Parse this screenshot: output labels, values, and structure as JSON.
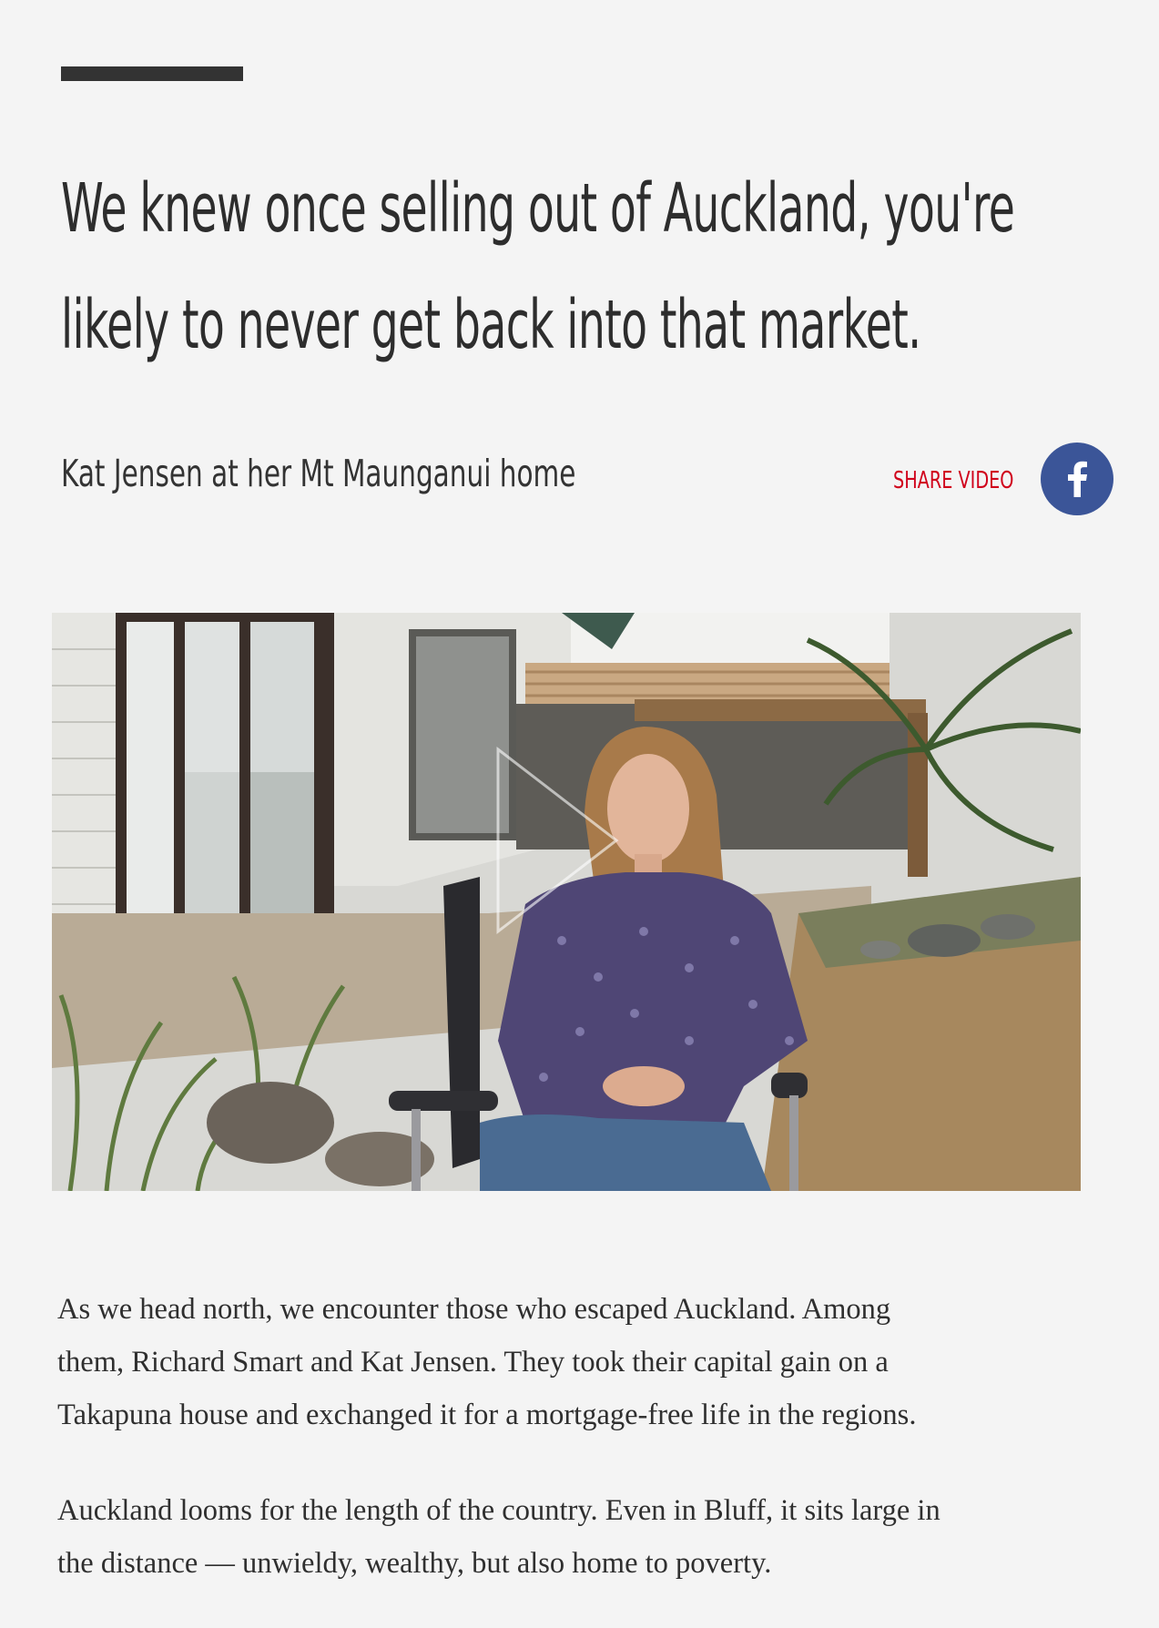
{
  "pull_quote": {
    "line1": "We knew once selling out of Auckland, you're",
    "line2": "likely to never get back into that market."
  },
  "video": {
    "caption": "Kat Jensen at her Mt Maunganui home",
    "share_label": "SHARE VIDEO",
    "share_icon": "facebook-icon",
    "play_icon": "play-icon"
  },
  "body": {
    "p1_line1": "As we head north, we encounter those who escaped Auckland. Among",
    "p1_line2": "them, Richard Smart and Kat Jensen. They took their capital gain on a",
    "p1_line3": "Takapuna house and exchanged it for a mortgage-free life in the regions.",
    "p2_line1": "Auckland looms for the length of the country. Even in Bluff, it sits large in",
    "p2_line2": "the distance — unwieldy, wealthy, but also home to poverty."
  },
  "colors": {
    "background": "#f4f4f4",
    "rule": "#333333",
    "share_red": "#d0021b",
    "facebook_blue": "#3b5598"
  }
}
